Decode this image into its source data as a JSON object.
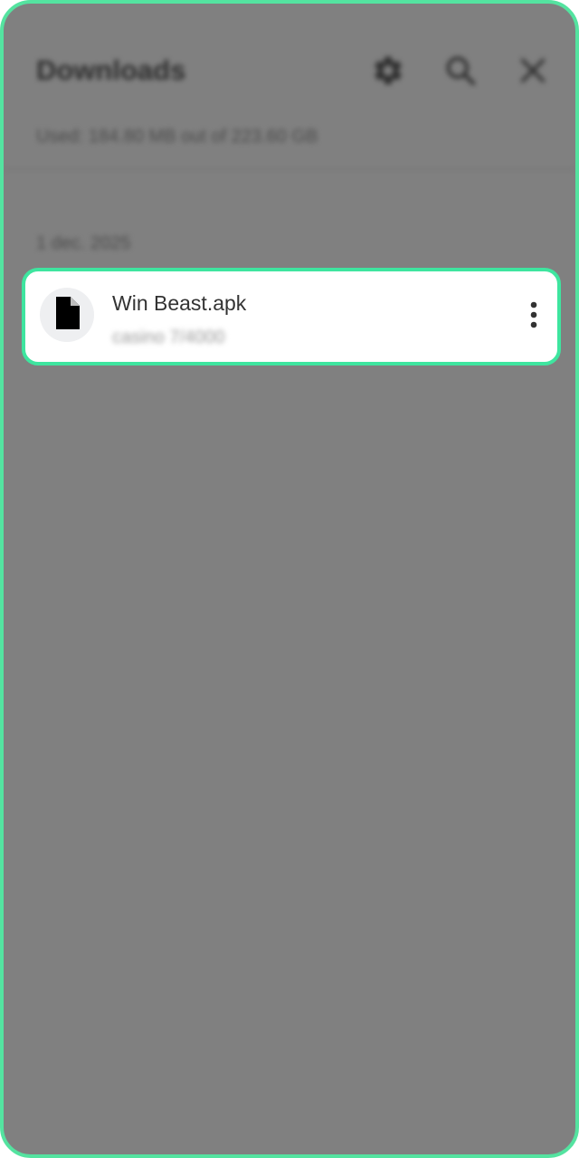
{
  "header": {
    "title": "Downloads",
    "settings_icon": "gear-icon",
    "search_icon": "search-icon",
    "close_icon": "close-icon"
  },
  "storage": {
    "usage_text": "Used: 184.80 MB out of 223.60 GB"
  },
  "groups": [
    {
      "date_label": "1 dec. 2025",
      "items": [
        {
          "file_name": "Win Beast.apk",
          "meta_text": "casino 7/4000",
          "icon": "file-icon",
          "menu_icon": "more-vert-icon"
        }
      ]
    }
  ],
  "colors": {
    "highlight_border": "#3ee59f",
    "frame_border": "#54e3a0",
    "dim_overlay": "#808080"
  }
}
